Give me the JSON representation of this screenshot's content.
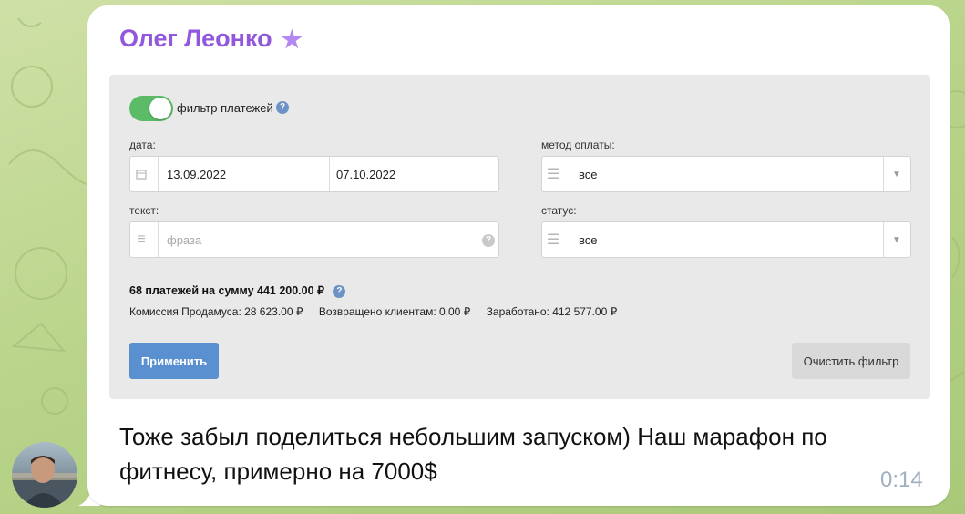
{
  "message": {
    "sender": "Олег Леонко",
    "text": "Тоже забыл поделиться небольшим запуском) Наш марафон по фитнесу, примерно на 7000$",
    "time": "0:14"
  },
  "filter": {
    "toggle_label": "фильтр платежей",
    "toggle_on": true,
    "date_label": "дата:",
    "date_from": "13.09.2022",
    "date_to": "07.10.2022",
    "method_label": "метод оплаты:",
    "method_value": "все",
    "text_label": "текст:",
    "text_placeholder": "фраза",
    "status_label": "статус:",
    "status_value": "все",
    "summary": "68 платежей на сумму 441 200.00 ₽",
    "commission": "Комиссия Продамуса: 28 623.00 ₽",
    "returned": "Возвращено клиентам: 0.00 ₽",
    "earned": "Заработано: 412 577.00 ₽",
    "apply_button": "Применить",
    "clear_button": "Очистить фильтр"
  },
  "colors": {
    "sender": "#9157dc",
    "toggle": "#5bbb66",
    "apply_button": "#5a8fd0",
    "help_icon": "#6d92c6",
    "chat_background": "#b9d48a"
  },
  "icons": [
    "star-icon",
    "help-icon",
    "calendar-icon",
    "list-icon",
    "text-icon",
    "chevron-down-icon"
  ]
}
